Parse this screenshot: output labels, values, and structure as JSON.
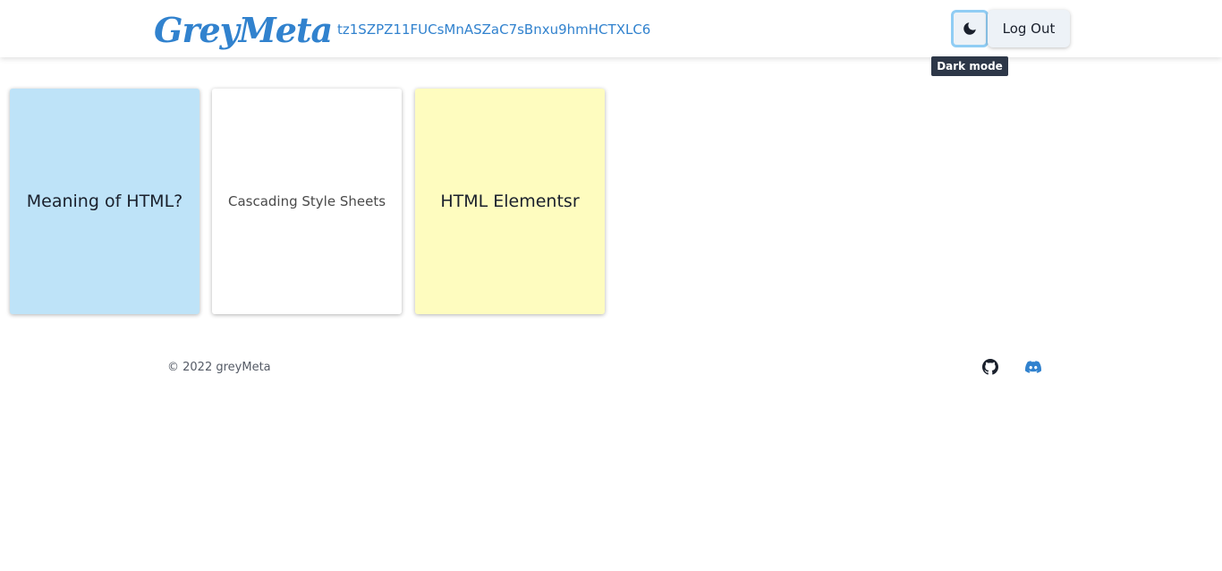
{
  "header": {
    "logo_text": "GreyMeta",
    "user_id": "tz1SZPZ11FUCsMnASZaC7sBnxu9hmHCTXLC6",
    "theme_toggle_icon": "moon-icon",
    "logout_label": "Log Out",
    "tooltip": "Dark mode"
  },
  "cards": [
    {
      "title": "Meaning of HTML?",
      "color": "#bee3f8"
    },
    {
      "title": "Cascading Style Sheets",
      "color": "#ffffff"
    },
    {
      "title": "HTML Elementsr",
      "color": "#fefcbf"
    }
  ],
  "footer": {
    "copyright": "© 2022 greyMeta",
    "social": [
      {
        "icon": "github-icon",
        "color": "#1a202c"
      },
      {
        "icon": "discord-icon",
        "color": "#3182ce"
      }
    ]
  },
  "colors": {
    "brand": "#3182ce",
    "tooltip_bg": "#2d3748",
    "button_bg": "#edf2f7"
  }
}
